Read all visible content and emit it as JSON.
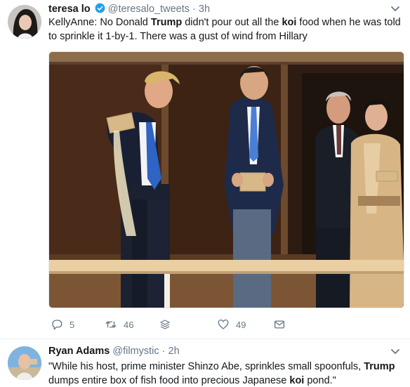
{
  "main_tweet": {
    "display_name": "teresa lo",
    "handle": "@teresalo_tweets",
    "separator": "·",
    "timestamp": "3h",
    "text_parts": {
      "p1": "KellyAnne: No Donald ",
      "b1": "Trump",
      "p2": " didn't pour out all the ",
      "b2": "koi",
      "p3": " food when he was told to sprinkle it 1-by-1. There was a gust of wind from Hillary"
    },
    "actions": {
      "reply_count": "5",
      "retweet_count": "46",
      "like_count": "49"
    }
  },
  "reply_tweet": {
    "display_name": "Ryan Adams",
    "handle": "@filmystic",
    "separator": "·",
    "timestamp": "2h",
    "text_parts": {
      "p1": "\"While his host, prime minister Shinzo Abe, sprinkles small spoonfuls, ",
      "b1": "Trump",
      "p2": " dumps entire box of fish food into precious Japanese ",
      "b2": "koi",
      "p3": " pond.\""
    }
  },
  "colors": {
    "link_blue": "#1da1f2",
    "secondary_text": "#657786",
    "primary_text": "#14171a",
    "divider": "#e6ecf0"
  },
  "icons": {
    "verified": "verified-badge-icon",
    "caret": "chevron-down-icon",
    "reply": "reply-icon",
    "retweet": "retweet-icon",
    "stack": "layers-icon",
    "like": "heart-icon",
    "dm": "envelope-icon"
  }
}
